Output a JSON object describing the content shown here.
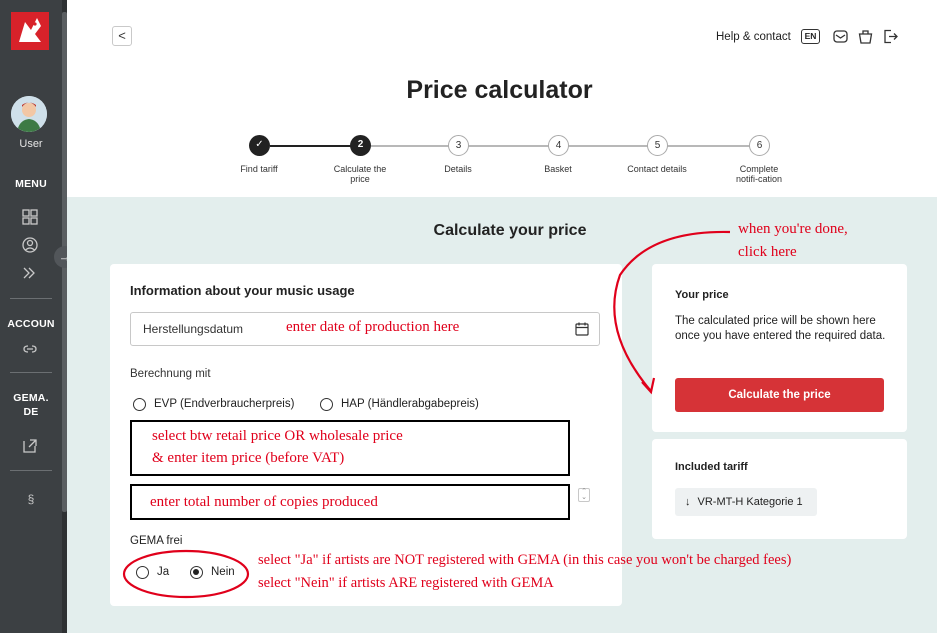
{
  "sidebar": {
    "user_label": "User",
    "menu_label": "MENU",
    "account_label": "ACCOUN",
    "gema_label_1": "GEMA.",
    "gema_label_2": "DE",
    "section_symbol": "§",
    "expand_arrow": "→"
  },
  "header": {
    "back_glyph": "<",
    "help": "Help & contact",
    "lang": "EN",
    "title": "Price calculator"
  },
  "steps": [
    {
      "num": "✓",
      "label": "Find tariff",
      "state": "done"
    },
    {
      "num": "2",
      "label": "Calculate the price",
      "state": "active"
    },
    {
      "num": "3",
      "label": "Details",
      "state": "pending"
    },
    {
      "num": "4",
      "label": "Basket",
      "state": "pending"
    },
    {
      "num": "5",
      "label": "Contact details",
      "state": "pending"
    },
    {
      "num": "6",
      "label": "Complete notifi-cation",
      "state": "pending"
    }
  ],
  "form": {
    "section_title": "Calculate your price",
    "card_title": "Information about your music usage",
    "date_placeholder": "Herstellungsdatum",
    "calc_label": "Berechnung mit",
    "option_evp": "EVP (Endverbraucherpreis)",
    "option_hap": "HAP (Händlerabgabepreis)",
    "gema_label": "GEMA frei",
    "option_ja": "Ja",
    "option_nein": "Nein",
    "gema_selected": "Nein"
  },
  "price_card": {
    "title": "Your price",
    "text": "The calculated price will be shown here once you have entered the required data.",
    "button": "Calculate the price"
  },
  "tariff_card": {
    "title": "Included tariff",
    "chip": "VR-MT-H Kategorie 1",
    "chip_icon": "↓"
  },
  "annotations": {
    "date": "enter date of production here",
    "price_1": "select btw retail price OR wholesale price",
    "price_2": "& enter item price (before VAT)",
    "copies": "enter total number of copies produced",
    "done_1": "when you're done,",
    "done_2": "click here",
    "gema_1": "select \"Ja\" if artists are NOT registered with GEMA (in this case you won't be charged fees)",
    "gema_2": "select \"Nein\" if artists ARE registered with GEMA"
  },
  "colors": {
    "sidebar": "#3c4043",
    "accent_red": "#d63337",
    "main_bg": "#e3eeed",
    "annotation": "#e0001b"
  }
}
